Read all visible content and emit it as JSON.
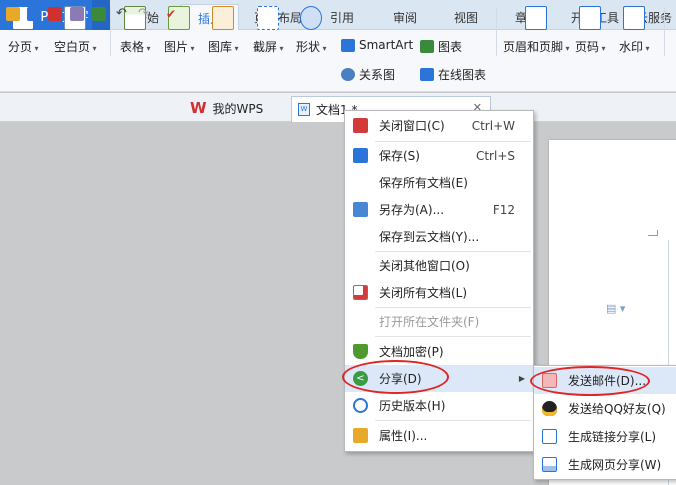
{
  "app": {
    "title": "WPS 文字",
    "logo": "W"
  },
  "tabs": [
    {
      "label": "开始"
    },
    {
      "label": "插入",
      "active": true
    },
    {
      "label": "页面布局"
    },
    {
      "label": "引用"
    },
    {
      "label": "审阅"
    },
    {
      "label": "视图"
    },
    {
      "label": "章节"
    },
    {
      "label": "开发工具"
    },
    {
      "label": "云服务"
    }
  ],
  "ribbon": {
    "page_break": "分页",
    "blank_page": "空白页",
    "table": "表格",
    "picture": "图片",
    "gallery": "图库",
    "screenshot": "截屏",
    "shape": "形状",
    "smartart": "SmartArt",
    "relation": "关系图",
    "chart": "图表",
    "online_chart": "在线图表",
    "header_footer": "页眉和页脚",
    "page_number": "页码",
    "watermark": "水印"
  },
  "doc_tabs": {
    "mywps": "我的WPS",
    "doc1": "文档1 *",
    "doc_icon_text": "W"
  },
  "context_menu": {
    "items": [
      {
        "label": "关闭窗口(C)",
        "shortcut": "Ctrl+W"
      },
      {
        "label": "保存(S)",
        "shortcut": "Ctrl+S"
      },
      {
        "label": "保存所有文档(E)"
      },
      {
        "label": "另存为(A)...",
        "shortcut": "F12"
      },
      {
        "label": "保存到云文档(Y)..."
      },
      {
        "label": "关闭其他窗口(O)"
      },
      {
        "label": "关闭所有文档(L)"
      },
      {
        "label": "打开所在文件夹(F)",
        "disabled": true
      },
      {
        "label": "文档加密(P)"
      },
      {
        "label": "分享(D)",
        "highlighted": true
      },
      {
        "label": "历史版本(H)"
      },
      {
        "label": "属性(I)..."
      }
    ]
  },
  "share_submenu": {
    "items": [
      {
        "label": "发送邮件(D)...",
        "highlighted": true
      },
      {
        "label": "发送给QQ好友(Q)"
      },
      {
        "label": "生成链接分享(L)"
      },
      {
        "label": "生成网页分享(W)"
      }
    ]
  },
  "colors": {
    "accent": "#2b74d9",
    "ribbon_bg": "#f6f8fb",
    "annotation_red": "#e02525"
  }
}
